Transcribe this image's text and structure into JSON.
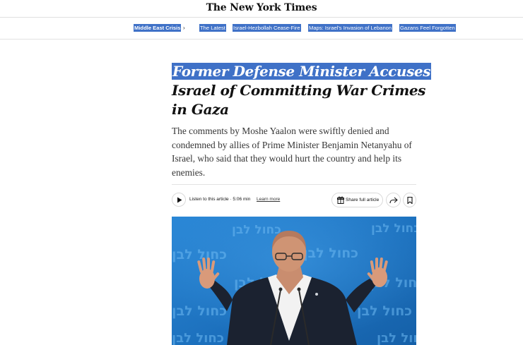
{
  "masthead": {
    "logo": "The New York Times"
  },
  "nav": {
    "section": "Middle East Crisis",
    "chevron": "›",
    "links": [
      "The Latest",
      "Israel-Hezbollah Cease-Fire",
      "Maps: Israel's Invasion of Lebanon",
      "Gazans Feel Forgotten"
    ]
  },
  "article": {
    "headline_line1": "Former Defense Minister Accuses",
    "headline_rest": "Israel of Committing War Crimes in Gaza",
    "summary": "The comments by Moshe Yaalon were swiftly denied and condemned by allies of Prime Minister Benjamin Netanyahu of Israel, who said that they would hurt the country and help its enemies."
  },
  "toolbar": {
    "listen_label": "Listen to this article · 5:06 min",
    "learn_more": "Learn more",
    "share_label": "Share full article"
  },
  "photo": {
    "backdrop_text": "כחול לבן"
  },
  "colors": {
    "selection": "#3f71c7",
    "photo_background": "#1f77c4",
    "text": "#121212"
  },
  "icons": [
    "play-icon",
    "gift-icon",
    "share-forward-icon",
    "bookmark-icon"
  ]
}
